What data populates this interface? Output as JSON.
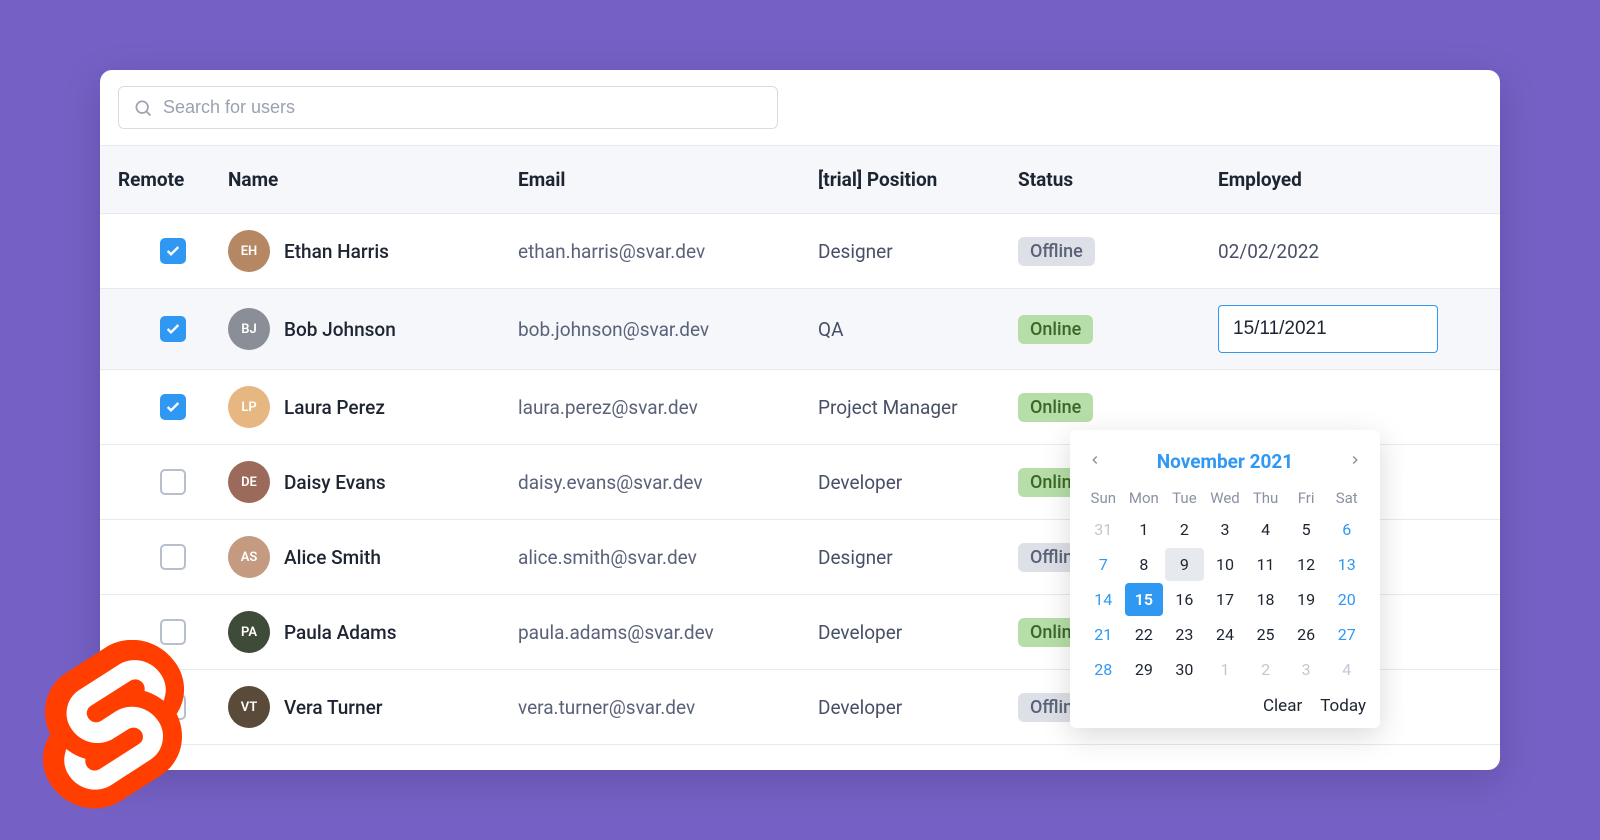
{
  "search": {
    "placeholder": "Search for users"
  },
  "columns": {
    "remote": "Remote",
    "name": "Name",
    "email": "Email",
    "position": "[trial] Position",
    "status": "Status",
    "employed": "Employed"
  },
  "status_labels": {
    "online": "Online",
    "offline": "Offline"
  },
  "rows": [
    {
      "remote": true,
      "name": "Ethan Harris",
      "email": "ethan.harris@svar.dev",
      "position": "Designer",
      "status": "offline",
      "employed": "02/02/2022",
      "avatar_bg": "#b58863"
    },
    {
      "remote": true,
      "name": "Bob Johnson",
      "email": "bob.johnson@svar.dev",
      "position": "QA",
      "status": "online",
      "employed": "15/11/2021",
      "avatar_bg": "#8a8f97",
      "editing": true
    },
    {
      "remote": true,
      "name": "Laura Perez",
      "email": "laura.perez@svar.dev",
      "position": "Project Manager",
      "status": "online",
      "employed": "",
      "avatar_bg": "#e6b780"
    },
    {
      "remote": false,
      "name": "Daisy Evans",
      "email": "daisy.evans@svar.dev",
      "position": "Developer",
      "status": "online",
      "employed": "",
      "avatar_bg": "#9b6a5b"
    },
    {
      "remote": false,
      "name": "Alice Smith",
      "email": "alice.smith@svar.dev",
      "position": "Designer",
      "status": "offline",
      "employed": "",
      "avatar_bg": "#c49a80"
    },
    {
      "remote": false,
      "name": "Paula Adams",
      "email": "paula.adams@svar.dev",
      "position": "Developer",
      "status": "online",
      "employed": "",
      "avatar_bg": "#3d4b38"
    },
    {
      "remote": false,
      "name": "Vera Turner",
      "email": "vera.turner@svar.dev",
      "position": "Developer",
      "status": "offline",
      "employed": "",
      "avatar_bg": "#5a4a3a"
    }
  ],
  "datepicker": {
    "title": "November 2021",
    "weekdays": [
      "Sun",
      "Mon",
      "Tue",
      "Wed",
      "Thu",
      "Fri",
      "Sat"
    ],
    "days": [
      {
        "n": 31,
        "muted": true
      },
      {
        "n": 1
      },
      {
        "n": 2
      },
      {
        "n": 3
      },
      {
        "n": 4
      },
      {
        "n": 5
      },
      {
        "n": 6,
        "weekend": true
      },
      {
        "n": 7,
        "weekend": true
      },
      {
        "n": 8
      },
      {
        "n": 9,
        "today": true
      },
      {
        "n": 10
      },
      {
        "n": 11
      },
      {
        "n": 12
      },
      {
        "n": 13,
        "weekend": true
      },
      {
        "n": 14,
        "weekend": true
      },
      {
        "n": 15,
        "selected": true
      },
      {
        "n": 16
      },
      {
        "n": 17
      },
      {
        "n": 18
      },
      {
        "n": 19
      },
      {
        "n": 20,
        "weekend": true
      },
      {
        "n": 21,
        "weekend": true
      },
      {
        "n": 22
      },
      {
        "n": 23
      },
      {
        "n": 24
      },
      {
        "n": 25
      },
      {
        "n": 26
      },
      {
        "n": 27,
        "weekend": true
      },
      {
        "n": 28,
        "weekend": true
      },
      {
        "n": 29
      },
      {
        "n": 30
      },
      {
        "n": 1,
        "muted": true
      },
      {
        "n": 2,
        "muted": true
      },
      {
        "n": 3,
        "muted": true
      },
      {
        "n": 4,
        "muted": true
      }
    ],
    "clear": "Clear",
    "today": "Today"
  }
}
